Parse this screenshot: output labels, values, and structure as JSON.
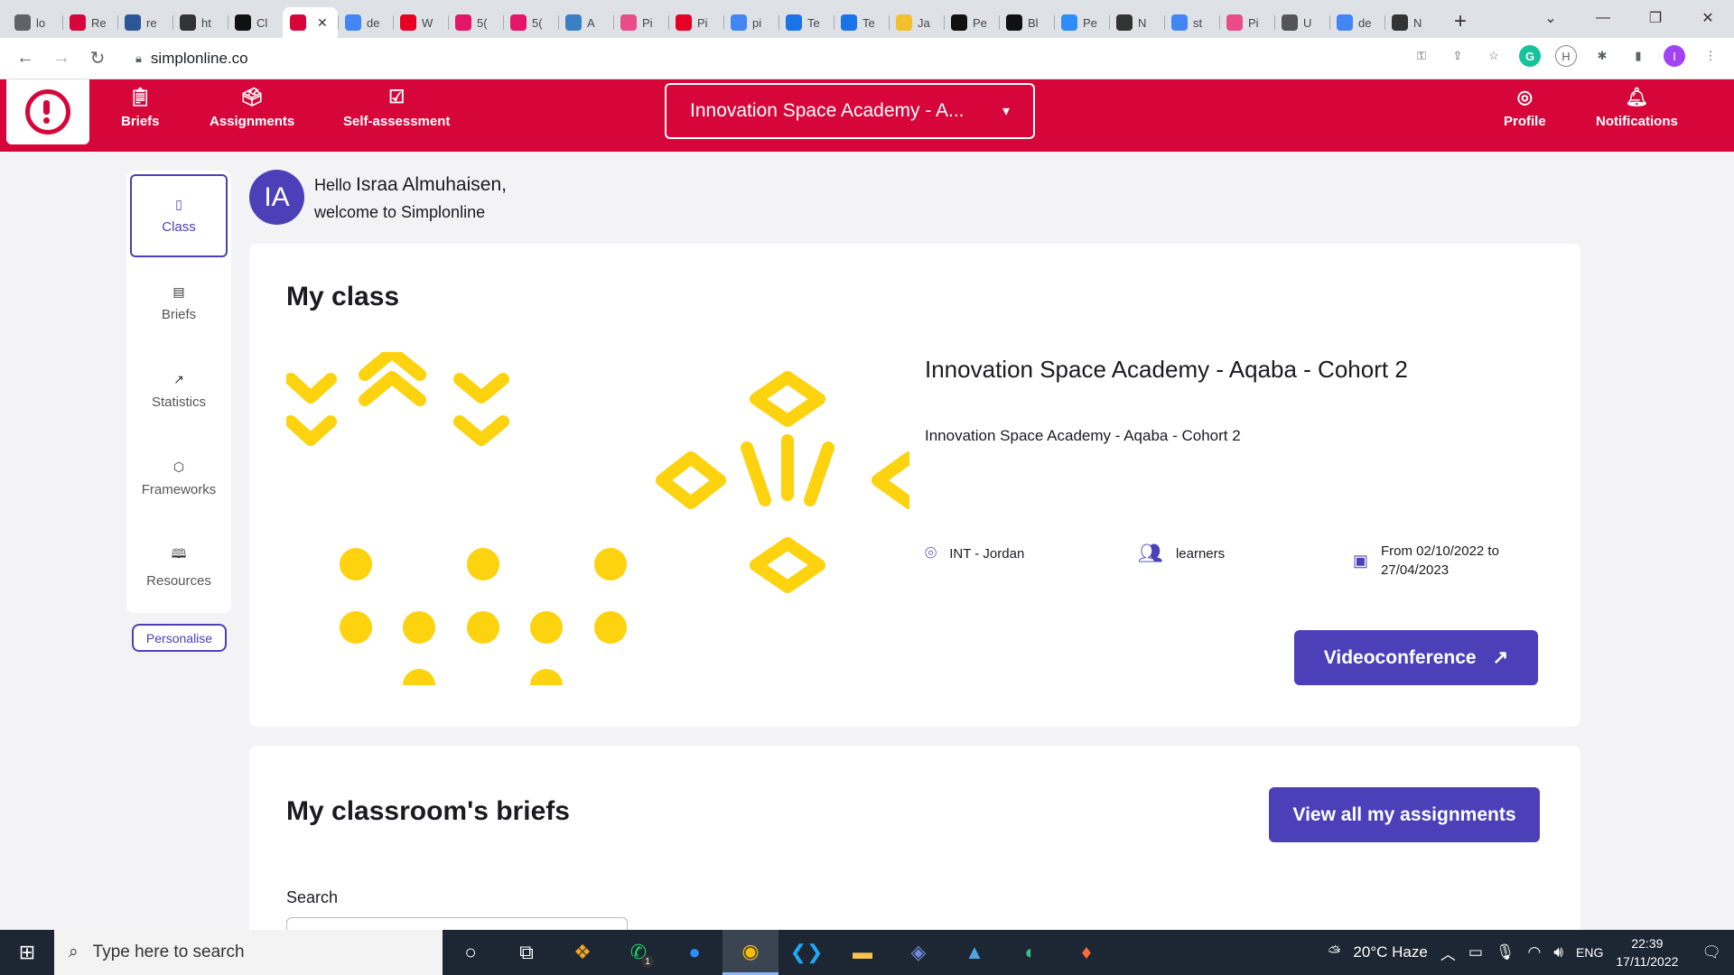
{
  "browser": {
    "tabs": [
      {
        "label": "lo",
        "icon": "globe-icon",
        "color": "#5f6368"
      },
      {
        "label": "Re",
        "icon": "r-icon",
        "color": "#d6063a"
      },
      {
        "label": "re",
        "icon": "r-box-icon",
        "color": "#2b5797"
      },
      {
        "label": "ht",
        "icon": "code-icon",
        "color": "#333333"
      },
      {
        "label": "Cl",
        "icon": "notion-icon",
        "color": "#111111"
      },
      {
        "label": "",
        "icon": "simplon-icon",
        "color": "#d6063a",
        "active": true
      },
      {
        "label": "de",
        "icon": "google-icon",
        "color": "#4285f4"
      },
      {
        "label": "W",
        "icon": "pinterest-icon",
        "color": "#e60023"
      },
      {
        "label": "5(",
        "icon": "m-icon",
        "color": "#e3166a"
      },
      {
        "label": "5(",
        "icon": "m-icon",
        "color": "#e3166a"
      },
      {
        "label": "A",
        "icon": "vue-icon",
        "color": "#3b80c4"
      },
      {
        "label": "Pi",
        "icon": "dribbble-icon",
        "color": "#ea4c89"
      },
      {
        "label": "Pi",
        "icon": "pinterest-icon",
        "color": "#e60023"
      },
      {
        "label": "pi",
        "icon": "google-icon",
        "color": "#4285f4"
      },
      {
        "label": "Te",
        "icon": "chart-icon",
        "color": "#1a73e8"
      },
      {
        "label": "Te",
        "icon": "chart-icon",
        "color": "#1a73e8"
      },
      {
        "label": "Ja",
        "icon": "miro-icon",
        "color": "#f2c12e"
      },
      {
        "label": "Pe",
        "icon": "codepen-icon",
        "color": "#111111"
      },
      {
        "label": "Bl",
        "icon": "codepen-icon",
        "color": "#111111"
      },
      {
        "label": "Pe",
        "icon": "zoom-icon",
        "color": "#2d8cff"
      },
      {
        "label": "N",
        "icon": "github-icon",
        "color": "#333333"
      },
      {
        "label": "st",
        "icon": "google-icon",
        "color": "#4285f4"
      },
      {
        "label": "Pi",
        "icon": "dribbble-icon",
        "color": "#ea4c89"
      },
      {
        "label": "U",
        "icon": "graduation-icon",
        "color": "#555555"
      },
      {
        "label": "de",
        "icon": "google-icon",
        "color": "#4285f4"
      },
      {
        "label": "N",
        "icon": "github-icon",
        "color": "#333333"
      }
    ],
    "new_tab": "+",
    "url": "simplonline.co",
    "profile_initial": "I"
  },
  "header": {
    "nav": [
      {
        "label": "Briefs",
        "icon": "clipboard-icon"
      },
      {
        "label": "Assignments",
        "icon": "assignment-icon"
      },
      {
        "label": "Self-assessment",
        "icon": "checklist-icon"
      }
    ],
    "academy_select": "Innovation Space Academy - A...",
    "right_nav": [
      {
        "label": "Profile",
        "icon": "user-circle-icon"
      },
      {
        "label": "Notifications",
        "icon": "bell-icon"
      }
    ],
    "brand_color": "#d6063a"
  },
  "sidebar": {
    "items": [
      {
        "label": "Class",
        "icon": "class-icon",
        "active": true
      },
      {
        "label": "Briefs",
        "icon": "clipboard-icon"
      },
      {
        "label": "Statistics",
        "icon": "trend-icon"
      },
      {
        "label": "Frameworks",
        "icon": "hexagon-icon"
      },
      {
        "label": "Resources",
        "icon": "book-icon"
      }
    ],
    "personalise_label": "Personalise"
  },
  "greeting": {
    "avatar_initials": "IA",
    "hello": "Hello",
    "name": "Israa Almuhaisen,",
    "welcome": "welcome to Simplonline"
  },
  "my_class": {
    "title": "My class",
    "class_name": "Innovation Space Academy - Aqaba - Cohort 2",
    "class_description": "Innovation Space Academy - Aqaba - Cohort 2",
    "location": "INT - Jordan",
    "learners": "learners",
    "dates": "From 02/10/2022 to 27/04/2023",
    "videoconference_label": "Videoconference",
    "accent_color": "#4b40b8",
    "decor_color": "#fdd20e"
  },
  "briefs": {
    "title": "My classroom's briefs",
    "view_all_label": "View all my assignments",
    "search_label": "Search"
  },
  "taskbar": {
    "search_placeholder": "Type here to search",
    "weather": "20°C  Haze",
    "language": "ENG",
    "time": "22:39",
    "date": "17/11/2022",
    "whatsapp_badge": "1"
  }
}
